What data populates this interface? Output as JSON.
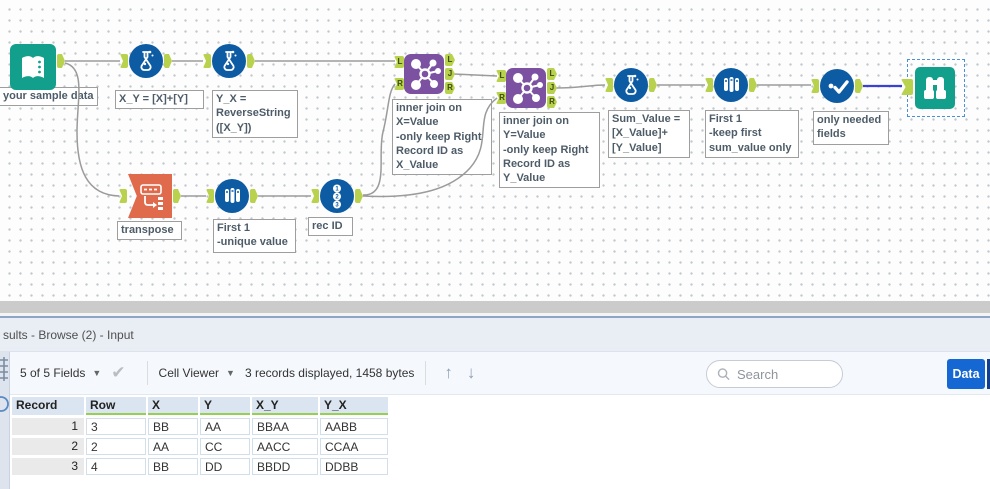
{
  "colors": {
    "teal": "#12a08d",
    "blue": "#0d5ba3",
    "orange": "#e06a4c",
    "purple": "#7c51a1",
    "anchor-green": "#b9d24d",
    "wire-selected": "#3a43cf",
    "btn-blue": "#1568d3",
    "green-underline": "#96cf52"
  },
  "canvas": {
    "tools": [
      {
        "id": "input",
        "label": "your sample data"
      },
      {
        "id": "formula-xy",
        "label": "X_Y = [X]+[Y]"
      },
      {
        "id": "formula-yx",
        "label": "Y_X =\nReverseString\n([X_Y])"
      },
      {
        "id": "transpose",
        "label": "transpose"
      },
      {
        "id": "sample-unique",
        "label": "First 1\n-unique value"
      },
      {
        "id": "record-id",
        "label": "rec ID"
      },
      {
        "id": "join-x",
        "label": "inner join on\nX=Value\n-only keep Right\nRecord ID as\nX_Value"
      },
      {
        "id": "join-y",
        "label": "inner join on\nY=Value\n-only keep Right\nRecord ID as\nY_Value"
      },
      {
        "id": "formula-sum",
        "label": "Sum_Value =\n[X_Value]+\n[Y_Value]"
      },
      {
        "id": "sample-keep-first",
        "label": "First 1\n-keep first\nsum_value only"
      },
      {
        "id": "select",
        "label": "only needed\nfields"
      }
    ],
    "join_anchor_labels": {
      "in_left": "L",
      "in_right": "R",
      "out_left": "L",
      "out_join": "J",
      "out_right": "R"
    },
    "record_id_digits": {
      "one": "1",
      "two": "2",
      "three": "3"
    }
  },
  "results": {
    "title": "sults - Browse (2) - Input",
    "toolbar": {
      "fields": "5 of 5 Fields",
      "cell_viewer": "Cell Viewer",
      "records_info": "3 records displayed, 1458 bytes",
      "search_placeholder": "Search",
      "data_button": "Data"
    },
    "table": {
      "headers": [
        "Record",
        "Row",
        "X",
        "Y",
        "X_Y",
        "Y_X"
      ],
      "rows": [
        [
          "1",
          "3",
          "BB",
          "AA",
          "BBAA",
          "AABB"
        ],
        [
          "2",
          "2",
          "AA",
          "CC",
          "AACC",
          "CCAA"
        ],
        [
          "3",
          "4",
          "BB",
          "DD",
          "BBDD",
          "DDBB"
        ]
      ]
    }
  }
}
